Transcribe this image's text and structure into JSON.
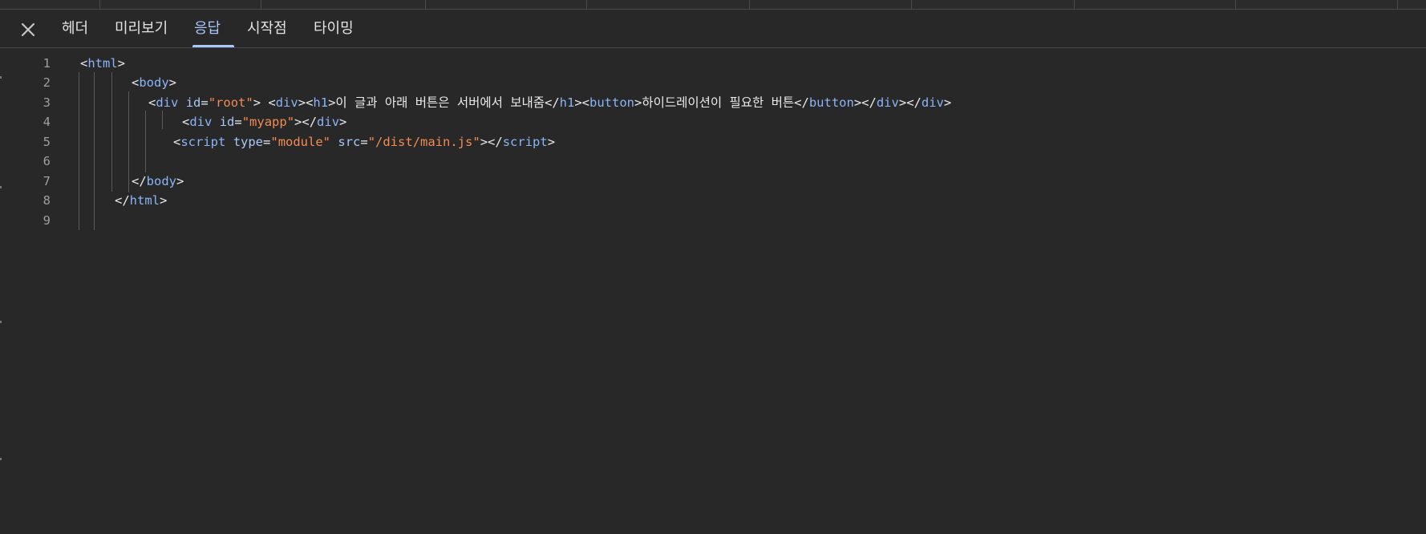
{
  "tabs": [
    {
      "label": "헤더"
    },
    {
      "label": "미리보기"
    },
    {
      "label": "응답",
      "active": true
    },
    {
      "label": "시작점"
    },
    {
      "label": "타이밍"
    }
  ],
  "line_numbers": [
    "1",
    "2",
    "3",
    "4",
    "5",
    "6",
    "7",
    "8",
    "9"
  ],
  "code": {
    "l1": {
      "lt": "<",
      "tag": "html",
      "gt": ">"
    },
    "l2": {
      "lt": "<",
      "tag": "body",
      "gt": ">"
    },
    "l3": {
      "lt1": "<",
      "tag1": "div",
      "sp1": " ",
      "attr1": "id",
      "eq1": "=",
      "val1": "\"root\"",
      "gt1": "> ",
      "lt2": "<",
      "tag2": "div",
      "gt2": ">",
      "lt3": "<",
      "tag3": "h1",
      "gt3": ">",
      "text1": "이 글과 아래 버튼은 서버에서 보내줌",
      "lt4": "</",
      "tag4": "h1",
      "gt4": ">",
      "lt5": "<",
      "tag5": "button",
      "gt5": ">",
      "text2": "하이드레이션이 필요한 버튼",
      "lt6": "</",
      "tag6": "button",
      "gt6": ">",
      "lt7": "</",
      "tag7": "div",
      "gt7": ">",
      "lt8": "</",
      "tag8": "div",
      "gt8": ">"
    },
    "l4": {
      "lt1": "<",
      "tag1": "div",
      "sp1": " ",
      "attr1": "id",
      "eq1": "=",
      "val1": "\"myapp\"",
      "gt1": ">",
      "lt2": "</",
      "tag2": "div",
      "gt2": ">"
    },
    "l5": {
      "lt1": "<",
      "tag1": "script",
      "sp1": " ",
      "attr1": "type",
      "eq1": "=",
      "val1": "\"module\"",
      "sp2": " ",
      "attr2": "src",
      "eq2": "=",
      "val2": "\"/dist/main.js\"",
      "gt1": ">",
      "lt2": "</",
      "tag2": "script",
      "gt2": ">"
    },
    "l7": {
      "lt": "</",
      "tag": "body",
      "gt": ">"
    },
    "l8": {
      "lt": "</",
      "tag": "html",
      "gt": ">"
    }
  },
  "colors": {
    "background": "#282828",
    "tag": "#8ab4f8",
    "string": "#f28b54",
    "active_tab": "#a8c7fa"
  },
  "icons": {
    "close": "close-icon"
  }
}
